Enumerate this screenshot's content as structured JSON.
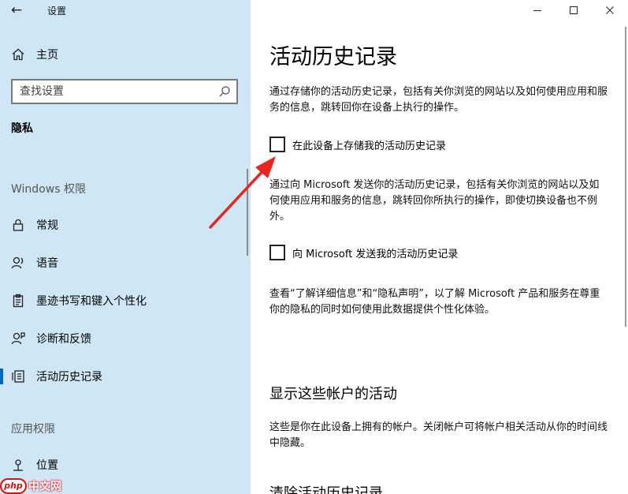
{
  "window": {
    "back_glyph": "←",
    "title": "设置"
  },
  "sidebar": {
    "home_label": "主页",
    "search_placeholder": "查找设置",
    "current_section": "隐私",
    "windows_group": "Windows 权限",
    "app_group": "应用权限",
    "items": [
      {
        "label": "常规",
        "icon": "lock-icon"
      },
      {
        "label": "语音",
        "icon": "speech-icon"
      },
      {
        "label": "墨迹书写和键入个性化",
        "icon": "clipboard-icon"
      },
      {
        "label": "诊断和反馈",
        "icon": "diagnostics-icon"
      },
      {
        "label": "活动历史记录",
        "icon": "activity-history-icon",
        "selected": true
      },
      {
        "label": "位置",
        "icon": "location-icon"
      }
    ]
  },
  "main": {
    "title": "活动历史记录",
    "desc1": "通过存储你的活动历史记录，包括有关你浏览的网站以及如何使用应用和服务的信息，跳转回你在设备上执行的操作。",
    "checkbox1_label": "在此设备上存储我的活动历史记录",
    "checkbox1_checked": false,
    "desc2": "通过向 Microsoft 发送你的活动历史记录，包括有关你浏览的网站以及如何使用应用和服务的信息，跳转回你所执行的操作，即使切换设备也不例外。",
    "checkbox2_label": "向 Microsoft 发送我的活动历史记录",
    "checkbox2_checked": false,
    "desc3": "查看“了解详细信息”和“隐私声明”，以了解 Microsoft 产品和服务在尊重你的隐私的同时如何使用此数据提供个性化体验。",
    "section2_title": "显示这些帐户的活动",
    "desc4": "这些是你在此设备上拥有的帐户。关闭帐户可将帐户相关活动从你的时间线中隐藏。",
    "section3_title": "清除活动历史记录"
  },
  "colors": {
    "sidebar_bg": "#cfe6f5",
    "accent": "#0067c0",
    "annotation_arrow": "#e8261f"
  },
  "watermark": {
    "logo": "php",
    "text": "中文网"
  }
}
